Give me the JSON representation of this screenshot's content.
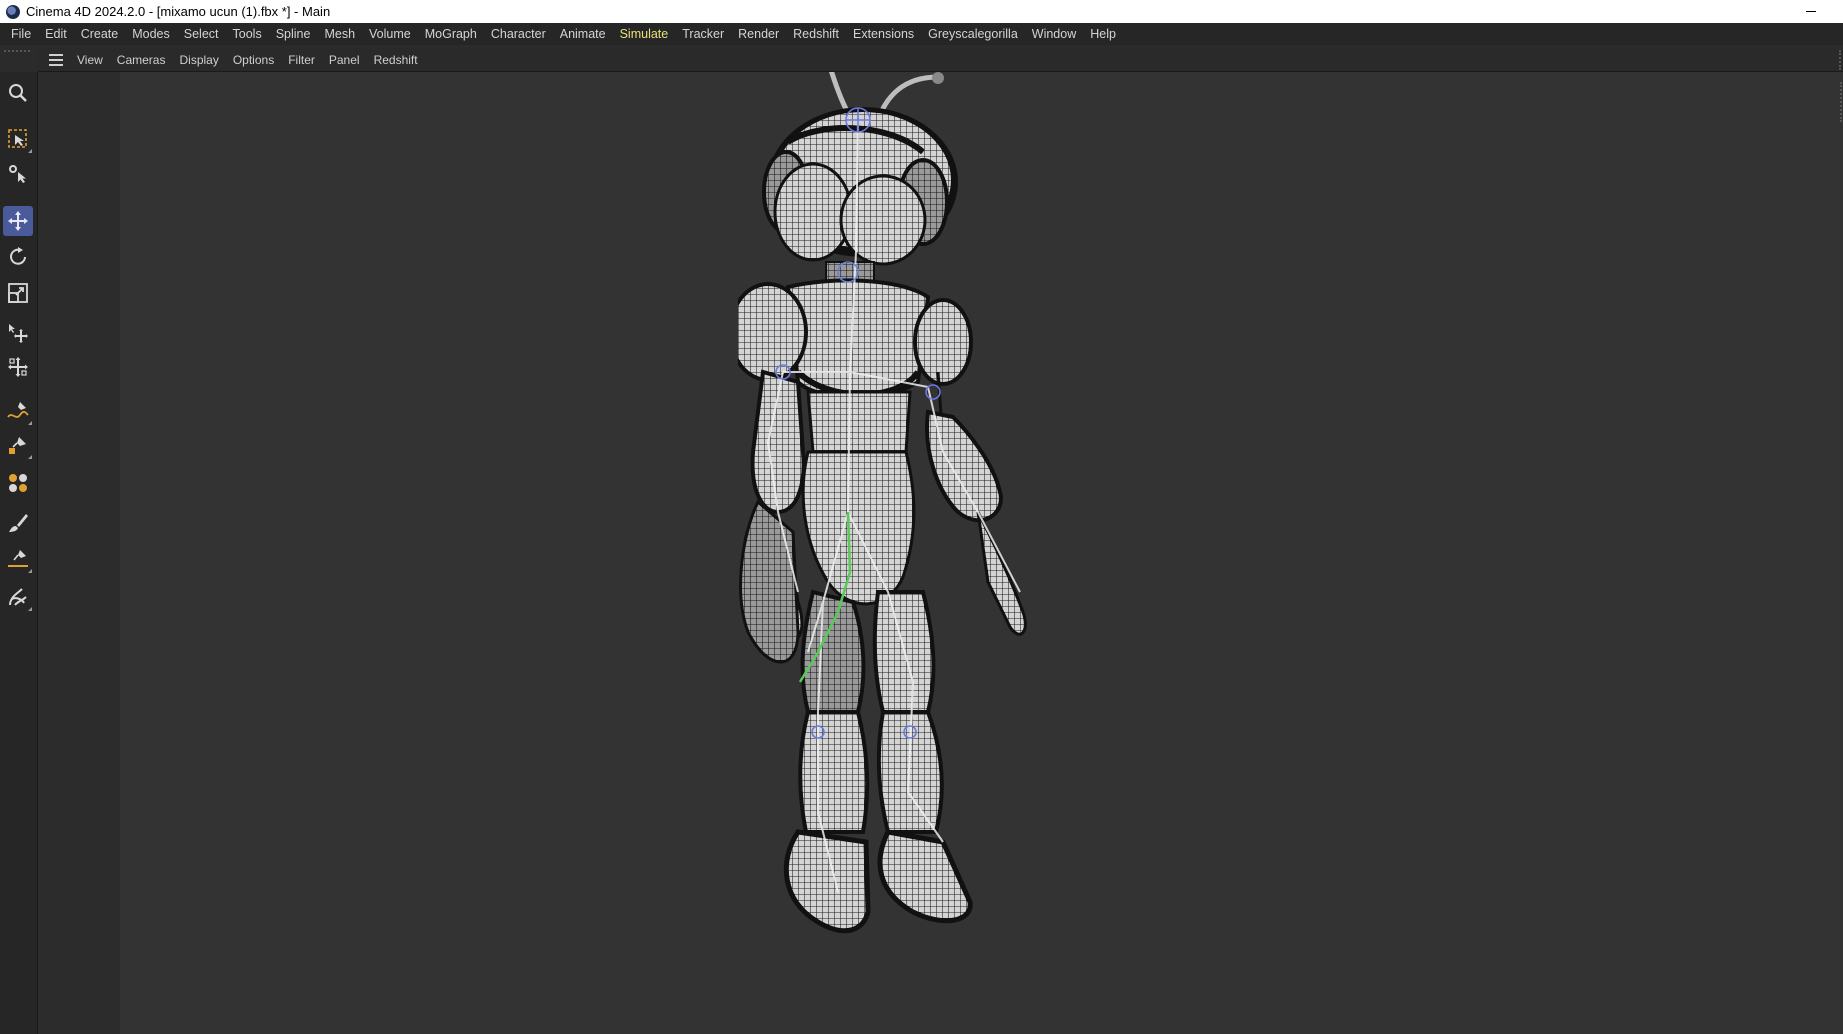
{
  "window": {
    "title": "Cinema 4D 2024.2.0 - [mixamo ucun (1).fbx *] - Main"
  },
  "menubar": {
    "items": [
      {
        "label": "File"
      },
      {
        "label": "Edit"
      },
      {
        "label": "Create"
      },
      {
        "label": "Modes"
      },
      {
        "label": "Select"
      },
      {
        "label": "Tools"
      },
      {
        "label": "Spline"
      },
      {
        "label": "Mesh"
      },
      {
        "label": "Volume"
      },
      {
        "label": "MoGraph"
      },
      {
        "label": "Character"
      },
      {
        "label": "Animate"
      },
      {
        "label": "Simulate"
      },
      {
        "label": "Tracker"
      },
      {
        "label": "Render"
      },
      {
        "label": "Redshift"
      },
      {
        "label": "Extensions"
      },
      {
        "label": "Greyscalegorilla"
      },
      {
        "label": "Window"
      },
      {
        "label": "Help"
      }
    ],
    "accent_color": "#e8e07a",
    "highlighted": "Simulate"
  },
  "viewport_menu": {
    "items": [
      {
        "label": "View"
      },
      {
        "label": "Cameras"
      },
      {
        "label": "Display"
      },
      {
        "label": "Options"
      },
      {
        "label": "Filter"
      },
      {
        "label": "Panel"
      },
      {
        "label": "Redshift"
      }
    ]
  },
  "toolbar": {
    "tools": [
      {
        "icon": "zoom-search-icon"
      },
      {
        "icon": "live-selection-icon"
      },
      {
        "icon": "tweak-icon"
      },
      {
        "icon": "move-icon",
        "active": true
      },
      {
        "icon": "rotate-icon"
      },
      {
        "icon": "scale-icon"
      },
      {
        "icon": "axis-move-icon"
      },
      {
        "icon": "transform-icon"
      },
      {
        "icon": "spline-pen-icon"
      },
      {
        "icon": "sculpt-pen-icon"
      },
      {
        "icon": "object-cubes-icon"
      },
      {
        "icon": "brush-icon"
      },
      {
        "icon": "knife-line-icon"
      },
      {
        "icon": "magnet-icon"
      }
    ],
    "active_color": "#4a5a9a"
  },
  "viewport": {
    "background": "#333333",
    "scene_object": "wireframe-character-rig"
  }
}
